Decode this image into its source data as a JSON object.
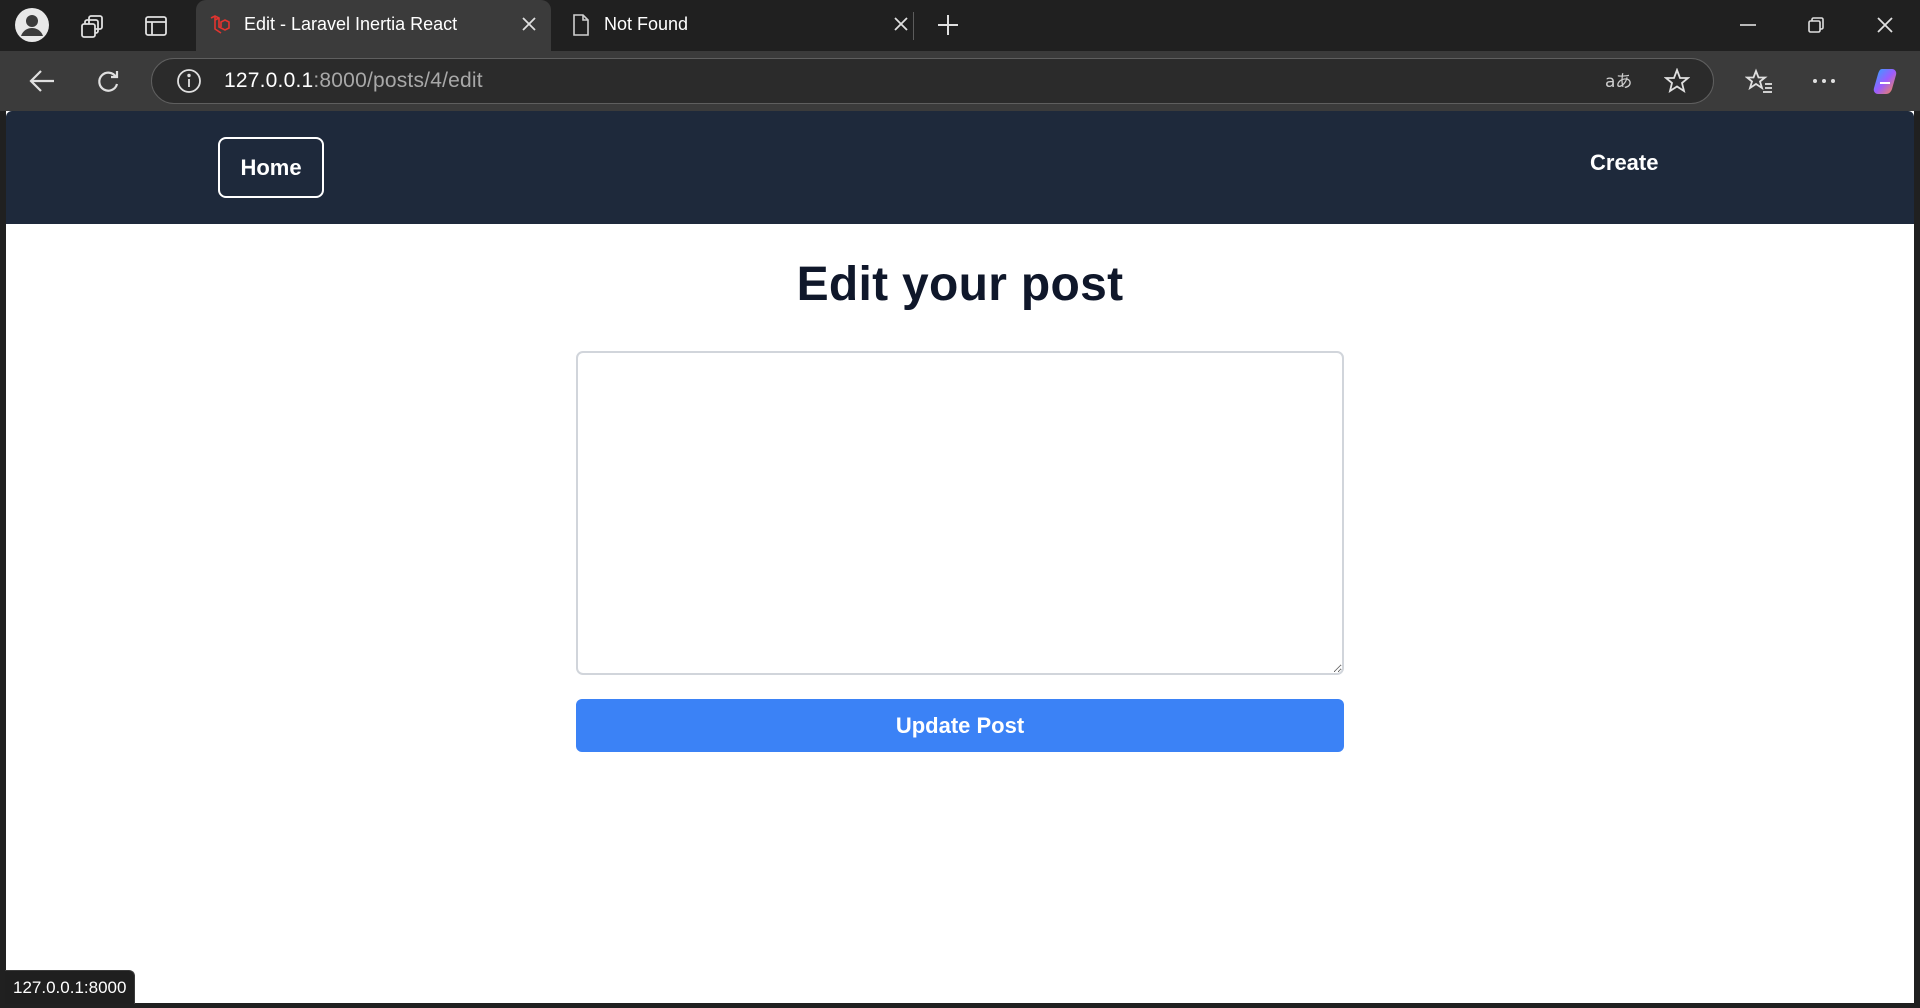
{
  "browser": {
    "tabs": [
      {
        "title": "Edit - Laravel Inertia React",
        "active": true,
        "favicon": "laravel-icon"
      },
      {
        "title": "Not Found",
        "active": false,
        "favicon": "document-icon"
      }
    ],
    "url_host": "127.0.0.1",
    "url_path": ":8000/posts/4/edit",
    "status_url": "127.0.0.1:8000"
  },
  "nav": {
    "home_label": "Home",
    "create_label": "Create"
  },
  "page": {
    "title": "Edit your post",
    "content_value": "",
    "update_label": "Update Post"
  },
  "colors": {
    "nav_bg": "#1e293b",
    "button_bg": "#3b82f6",
    "title_color": "#0f172a"
  }
}
